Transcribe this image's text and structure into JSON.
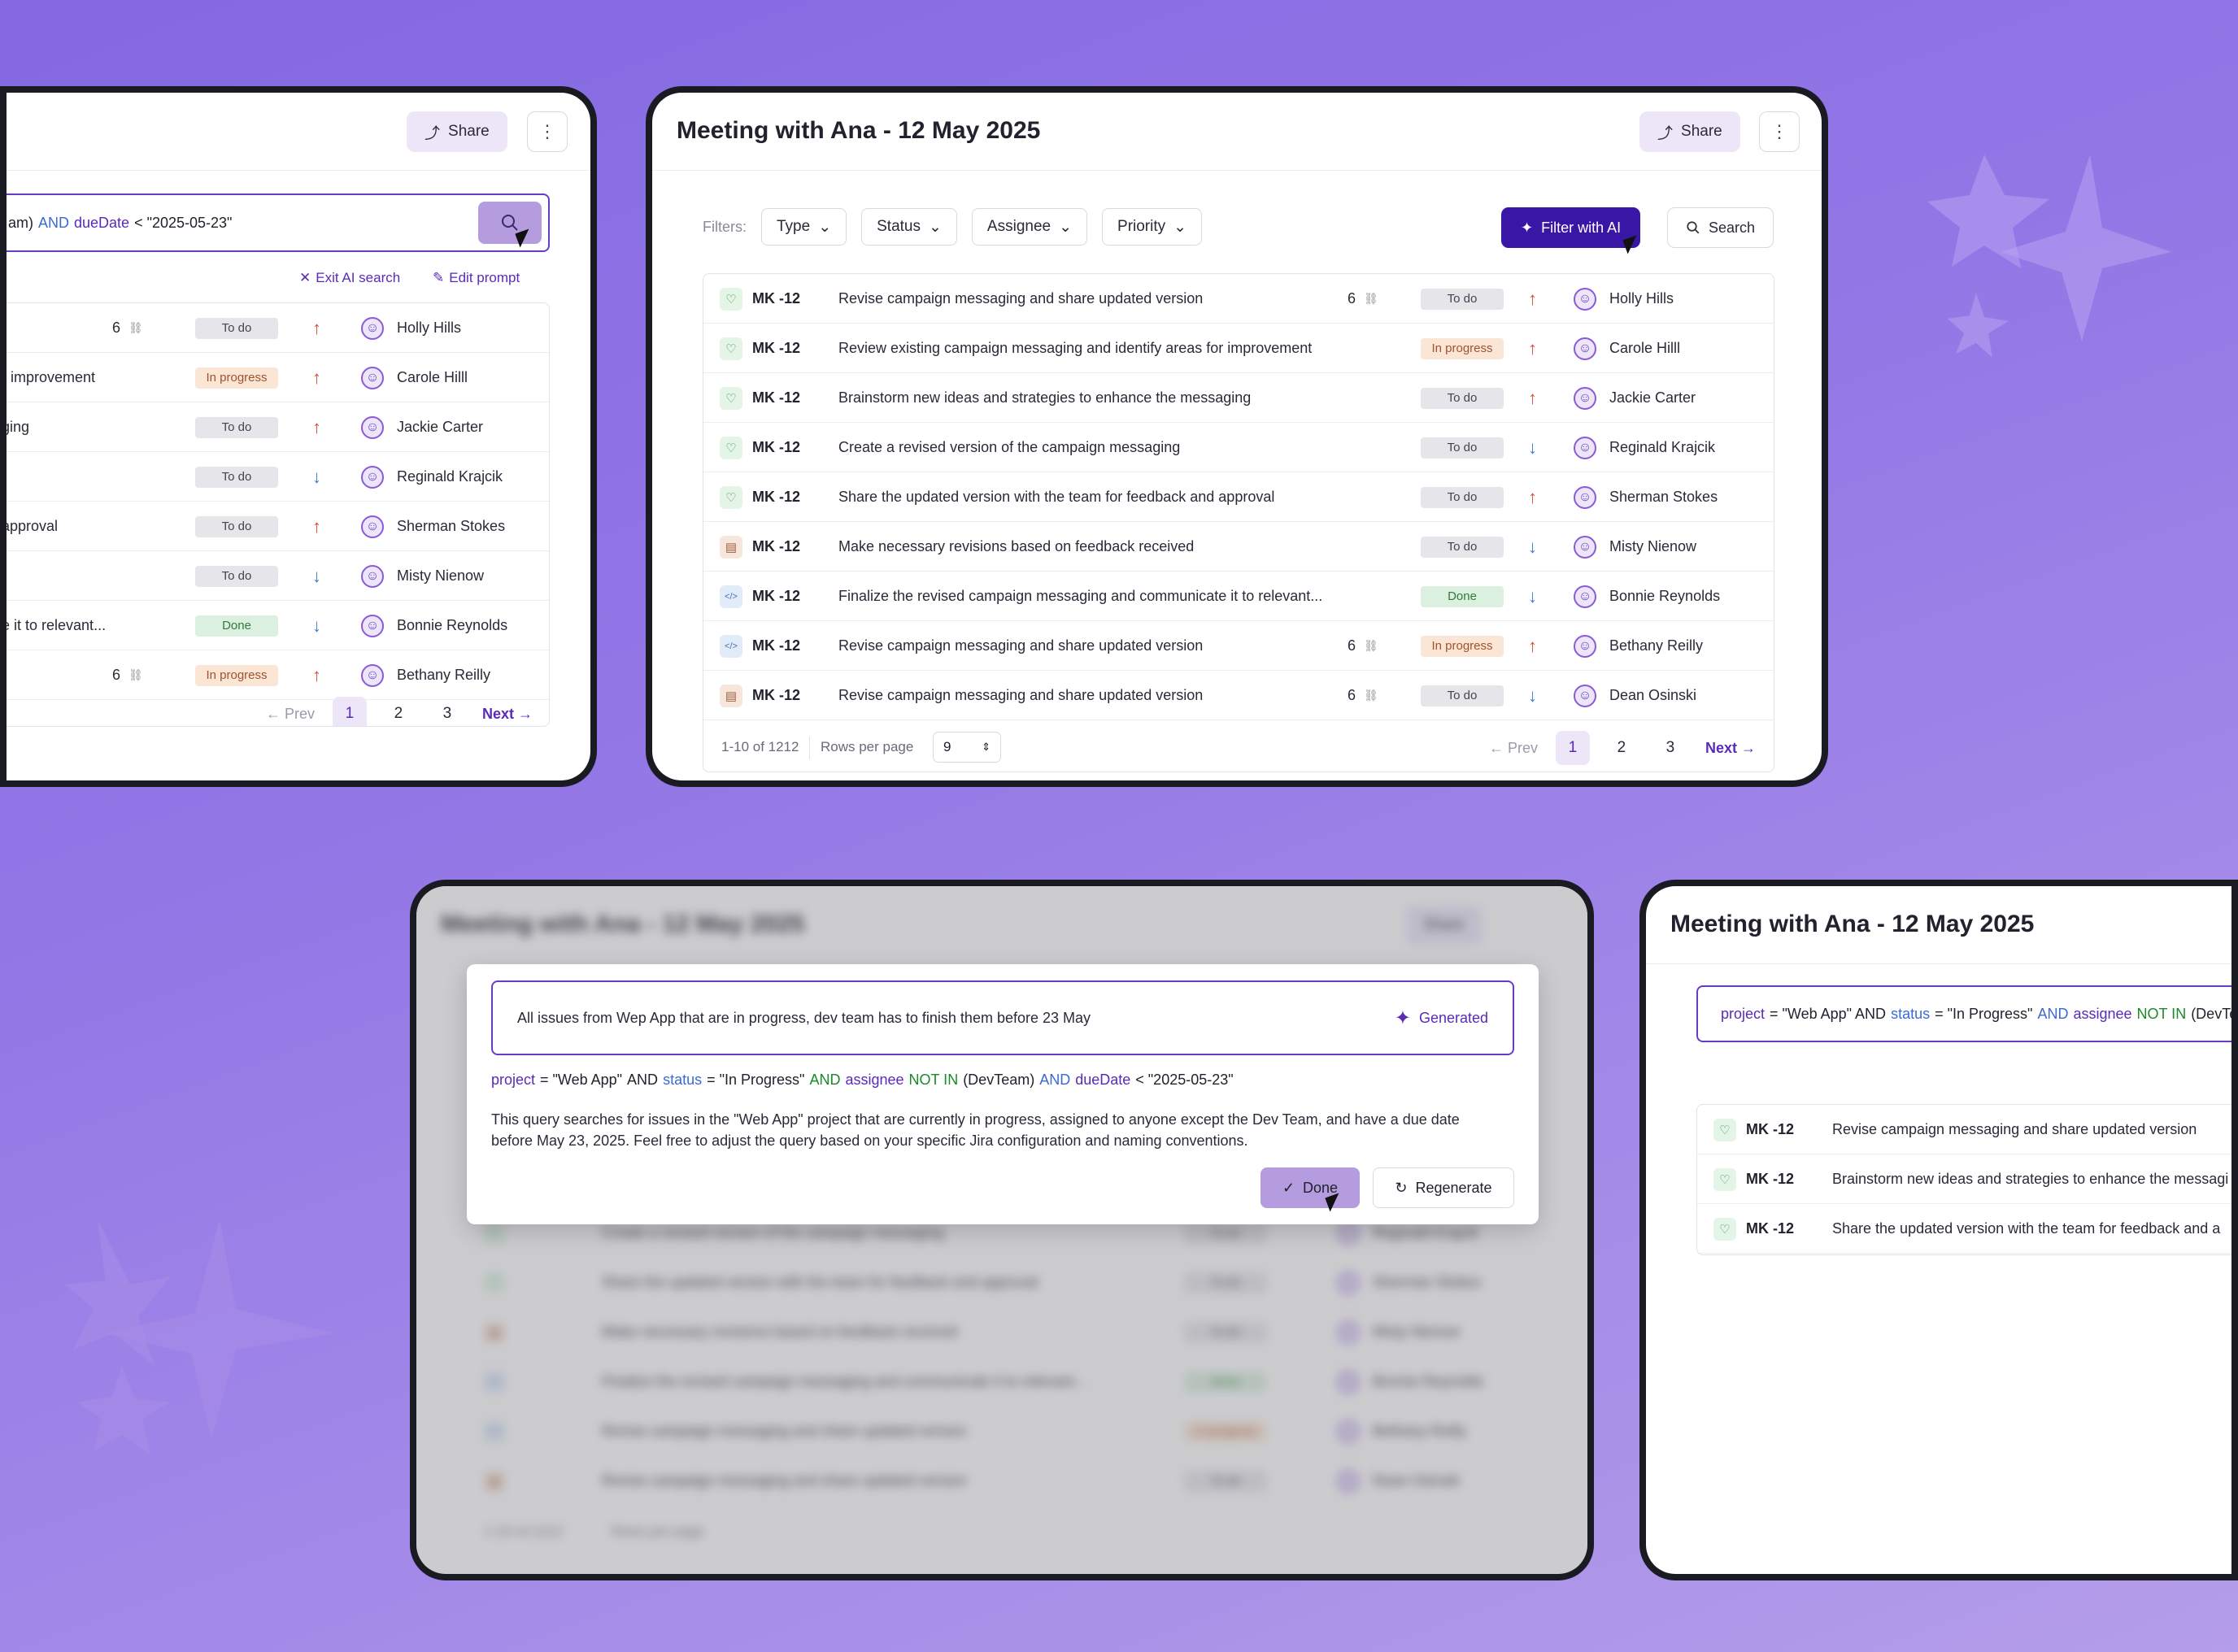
{
  "colors": {
    "accent": "#5a2ab8",
    "ai_button": "#3a16a6",
    "background": "#9377e6"
  },
  "icons": {
    "share": "share-icon",
    "more": "more-vertical-icon",
    "search": "search-icon",
    "sparkle": "sparkle-icon",
    "chevron": "chevron-down-icon",
    "close": "close-icon",
    "edit": "edit-icon",
    "check": "check-icon",
    "refresh": "refresh-icon",
    "subtask": "subtask-icon"
  },
  "common": {
    "share": "Share",
    "more": "⋮",
    "prev": "Prev",
    "next": "Next",
    "pages": [
      "1",
      "2",
      "3"
    ]
  },
  "left_panel": {
    "query_fragment_1": "am)",
    "query_and": "AND",
    "query_field": "dueDate",
    "query_rest": "< \"2025-05-23\"",
    "exit_ai": "Exit AI search",
    "edit_prompt": "Edit prompt",
    "rows": [
      {
        "summary": "",
        "count": "6",
        "status": "To do",
        "priority": "up",
        "assignee": "Holly Hills"
      },
      {
        "summary": "r improvement",
        "count": "",
        "status": "In progress",
        "priority": "up",
        "assignee": "Carole Hilll"
      },
      {
        "summary": "ging",
        "count": "",
        "status": "To do",
        "priority": "up",
        "assignee": "Jackie Carter"
      },
      {
        "summary": "",
        "count": "",
        "status": "To do",
        "priority": "down",
        "assignee": "Reginald Krajcik"
      },
      {
        "summary": "approval",
        "count": "",
        "status": "To do",
        "priority": "up",
        "assignee": "Sherman Stokes"
      },
      {
        "summary": "",
        "count": "",
        "status": "To do",
        "priority": "down",
        "assignee": "Misty Nienow"
      },
      {
        "summary": "e it to relevant...",
        "count": "",
        "status": "Done",
        "priority": "down",
        "assignee": "Bonnie Reynolds"
      },
      {
        "summary": "",
        "count": "6",
        "status": "In progress",
        "priority": "up",
        "assignee": "Bethany Reilly"
      }
    ]
  },
  "main_panel": {
    "title": "Meeting with Ana - 12 May 2025",
    "filters_label": "Filters:",
    "filters": [
      "Type",
      "Status",
      "Assignee",
      "Priority"
    ],
    "filter_ai": "Filter with AI",
    "search": "Search",
    "rows": [
      {
        "type": "story",
        "key": "MK -12",
        "summary": "Revise campaign messaging and share updated version",
        "count": "6",
        "status": "To do",
        "priority": "up",
        "assignee": "Holly Hills"
      },
      {
        "type": "story",
        "key": "MK -12",
        "summary": "Review existing campaign messaging and identify areas for improvement",
        "count": "",
        "status": "In progress",
        "priority": "up",
        "assignee": "Carole Hilll"
      },
      {
        "type": "story",
        "key": "MK -12",
        "summary": "Brainstorm new ideas and strategies to enhance the messaging",
        "count": "",
        "status": "To do",
        "priority": "up",
        "assignee": "Jackie Carter"
      },
      {
        "type": "story",
        "key": "MK -12",
        "summary": "Create a revised version of the campaign messaging",
        "count": "",
        "status": "To do",
        "priority": "down",
        "assignee": "Reginald Krajcik"
      },
      {
        "type": "story",
        "key": "MK -12",
        "summary": "Share the updated version with the team for feedback and approval",
        "count": "",
        "status": "To do",
        "priority": "up",
        "assignee": "Sherman Stokes"
      },
      {
        "type": "doc",
        "key": "MK -12",
        "summary": "Make necessary revisions based on feedback received",
        "count": "",
        "status": "To do",
        "priority": "down",
        "assignee": "Misty Nienow"
      },
      {
        "type": "code",
        "key": "MK -12",
        "summary": "Finalize the revised campaign messaging and communicate it to relevant...",
        "count": "",
        "status": "Done",
        "priority": "down",
        "assignee": "Bonnie Reynolds"
      },
      {
        "type": "code",
        "key": "MK -12",
        "summary": "Revise campaign messaging and share updated version",
        "count": "6",
        "status": "In progress",
        "priority": "up",
        "assignee": "Bethany Reilly"
      },
      {
        "type": "doc",
        "key": "MK -12",
        "summary": "Revise campaign messaging and share updated version",
        "count": "6",
        "status": "To do",
        "priority": "down",
        "assignee": "Dean Osinski"
      }
    ],
    "range": "1-10 of 1212",
    "rows_per_page_label": "Rows per page",
    "rows_per_page": "9"
  },
  "modal_panel": {
    "bg_title": "Meeting with Ana - 12 May 2025",
    "bg_share": "Share",
    "prompt": "All issues from Wep App that are in progress, dev team has to finish them before 23 May",
    "generated": "Generated",
    "q_project": "project",
    "q_eq1": "= \"Web App\"",
    "q_and1": "AND",
    "q_status": "status",
    "q_eq2": "= \"In Progress\"",
    "q_and2": "AND",
    "q_assignee": "assignee",
    "q_notin": "NOT IN",
    "q_devteam": "(DevTeam)",
    "q_and3": "AND",
    "q_duedate": "dueDate",
    "q_lt": "< \"2025-05-23\"",
    "explanation": "This query searches for issues in the \"Web App\" project that are currently in progress, assigned to anyone except the Dev Team, and have a due date before May 23, 2025. Feel free to adjust the query based on your specific Jira configuration and naming conventions.",
    "done": "Done",
    "regenerate": "Regenerate",
    "bg_rows": [
      {
        "summary": "Create a revised version of the campaign messaging",
        "status": "To do",
        "assignee": "Reginald Krajcik"
      },
      {
        "summary": "Share the updated version with the team for feedback and approval",
        "status": "To do",
        "assignee": "Sherman Stokes"
      },
      {
        "summary": "Make necessary revisions based on feedback received",
        "status": "To do",
        "assignee": "Misty Nienow"
      },
      {
        "summary": "Finalize the revised campaign messaging and communicate it to relevant...",
        "status": "Done",
        "assignee": "Bonnie Reynolds"
      },
      {
        "summary": "Revise campaign messaging and share updated version",
        "status": "In progress",
        "assignee": "Bethany Reilly"
      },
      {
        "summary": "Revise campaign messaging and share updated version",
        "status": "To do",
        "assignee": "Dean Osinski"
      }
    ],
    "bg_range": "1-10 of 1212",
    "bg_rpp": "Rows per page"
  },
  "right_panel": {
    "title": "Meeting with Ana - 12 May 2025",
    "q_project": "project",
    "q_eq1": "= \"Web App\" AND",
    "q_status": "status",
    "q_eq2": "= \"In Progress\"",
    "q_and": "AND",
    "q_assignee": "assignee",
    "q_notin": "NOT IN",
    "q_rest": "(DevTear",
    "rows": [
      {
        "key": "MK -12",
        "summary": "Revise campaign messaging and share updated version"
      },
      {
        "key": "MK -12",
        "summary": "Brainstorm new ideas and strategies to enhance the messagi"
      },
      {
        "key": "MK -12",
        "summary": "Share the updated version with the team for feedback and a"
      }
    ]
  }
}
